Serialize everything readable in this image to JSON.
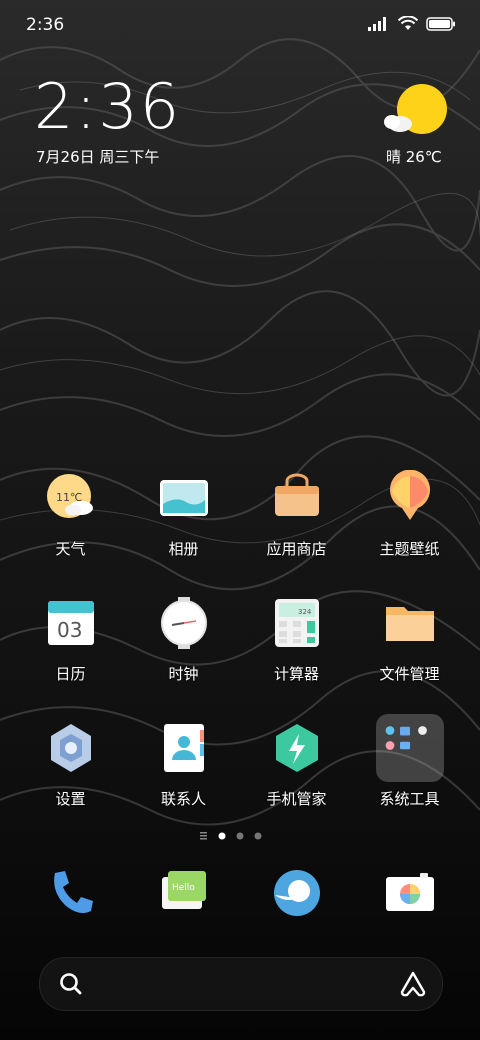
{
  "status_bar": {
    "time": "2:36",
    "icons": [
      "signal-icon",
      "wifi-icon",
      "battery-icon"
    ]
  },
  "clock": {
    "time": "2:36",
    "date": "7月26日 周三下午"
  },
  "weather": {
    "text": "晴 26℃",
    "icon": "sun-cloud-icon"
  },
  "apps": [
    [
      {
        "label": "天气",
        "icon": "weather-icon",
        "badge": "11℃"
      },
      {
        "label": "相册",
        "icon": "gallery-icon"
      },
      {
        "label": "应用商店",
        "icon": "app-store-icon"
      },
      {
        "label": "主题壁纸",
        "icon": "themes-icon"
      }
    ],
    [
      {
        "label": "日历",
        "icon": "calendar-icon",
        "badge": "03"
      },
      {
        "label": "时钟",
        "icon": "clock-icon"
      },
      {
        "label": "计算器",
        "icon": "calculator-icon",
        "badge": "324"
      },
      {
        "label": "文件管理",
        "icon": "folder-icon"
      }
    ],
    [
      {
        "label": "设置",
        "icon": "settings-icon"
      },
      {
        "label": "联系人",
        "icon": "contacts-icon"
      },
      {
        "label": "手机管家",
        "icon": "security-icon"
      },
      {
        "label": "系统工具",
        "icon": "tools-folder-icon"
      }
    ]
  ],
  "page_indicator": {
    "pages": 3,
    "current": 1
  },
  "dock": [
    {
      "icon": "phone-icon"
    },
    {
      "icon": "messages-icon",
      "badge": "Hello"
    },
    {
      "icon": "browser-icon"
    },
    {
      "icon": "camera-icon"
    }
  ],
  "search_bar": {
    "left_icon": "search-icon",
    "right_icon": "assistant-icon"
  },
  "colors": {
    "weather_sun": "#ffd21a",
    "calendar_teal": "#45c1d0",
    "security_green": "#3cc9a0"
  }
}
